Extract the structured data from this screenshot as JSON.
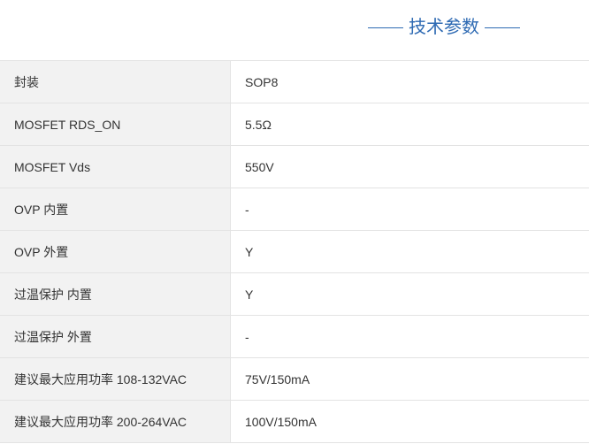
{
  "section_title": "技术参数",
  "colors": {
    "accent": "#2e6ab3",
    "label_bg": "#f2f2f2",
    "border": "#e3e3e3",
    "text": "#333333"
  },
  "specs": [
    {
      "label": "封装",
      "value": "SOP8"
    },
    {
      "label": "MOSFET RDS_ON",
      "value": "5.5Ω"
    },
    {
      "label": "MOSFET Vds",
      "value": "550V"
    },
    {
      "label": "OVP 内置",
      "value": "-"
    },
    {
      "label": "OVP 外置",
      "value": "Y"
    },
    {
      "label": "过温保护 内置",
      "value": "Y"
    },
    {
      "label": "过温保护 外置",
      "value": "-"
    },
    {
      "label": "建议最大应用功率 108-132VAC",
      "value": "75V/150mA"
    },
    {
      "label": "建议最大应用功率 200-264VAC",
      "value": "100V/150mA"
    }
  ]
}
